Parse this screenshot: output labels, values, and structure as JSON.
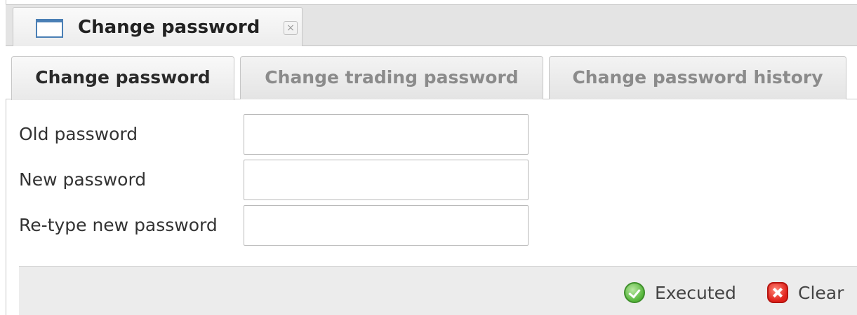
{
  "window": {
    "tab_title": "Change password",
    "icon": "window-icon",
    "close_symbol": "×"
  },
  "tabs": [
    {
      "label": "Change password",
      "active": true
    },
    {
      "label": "Change trading password",
      "active": false
    },
    {
      "label": "Change password history",
      "active": false
    }
  ],
  "form": {
    "fields": [
      {
        "label": "Old password",
        "value": ""
      },
      {
        "label": "New password",
        "value": ""
      },
      {
        "label": "Re-type new password",
        "value": ""
      }
    ]
  },
  "actions": {
    "executed_label": "Executed",
    "executed_icon": "check-circle-icon",
    "clear_label": "Clear",
    "clear_icon": "close-icon"
  },
  "colors": {
    "accent": "#4a7fb5",
    "ok": "#55b53a",
    "danger": "#e0211b"
  }
}
